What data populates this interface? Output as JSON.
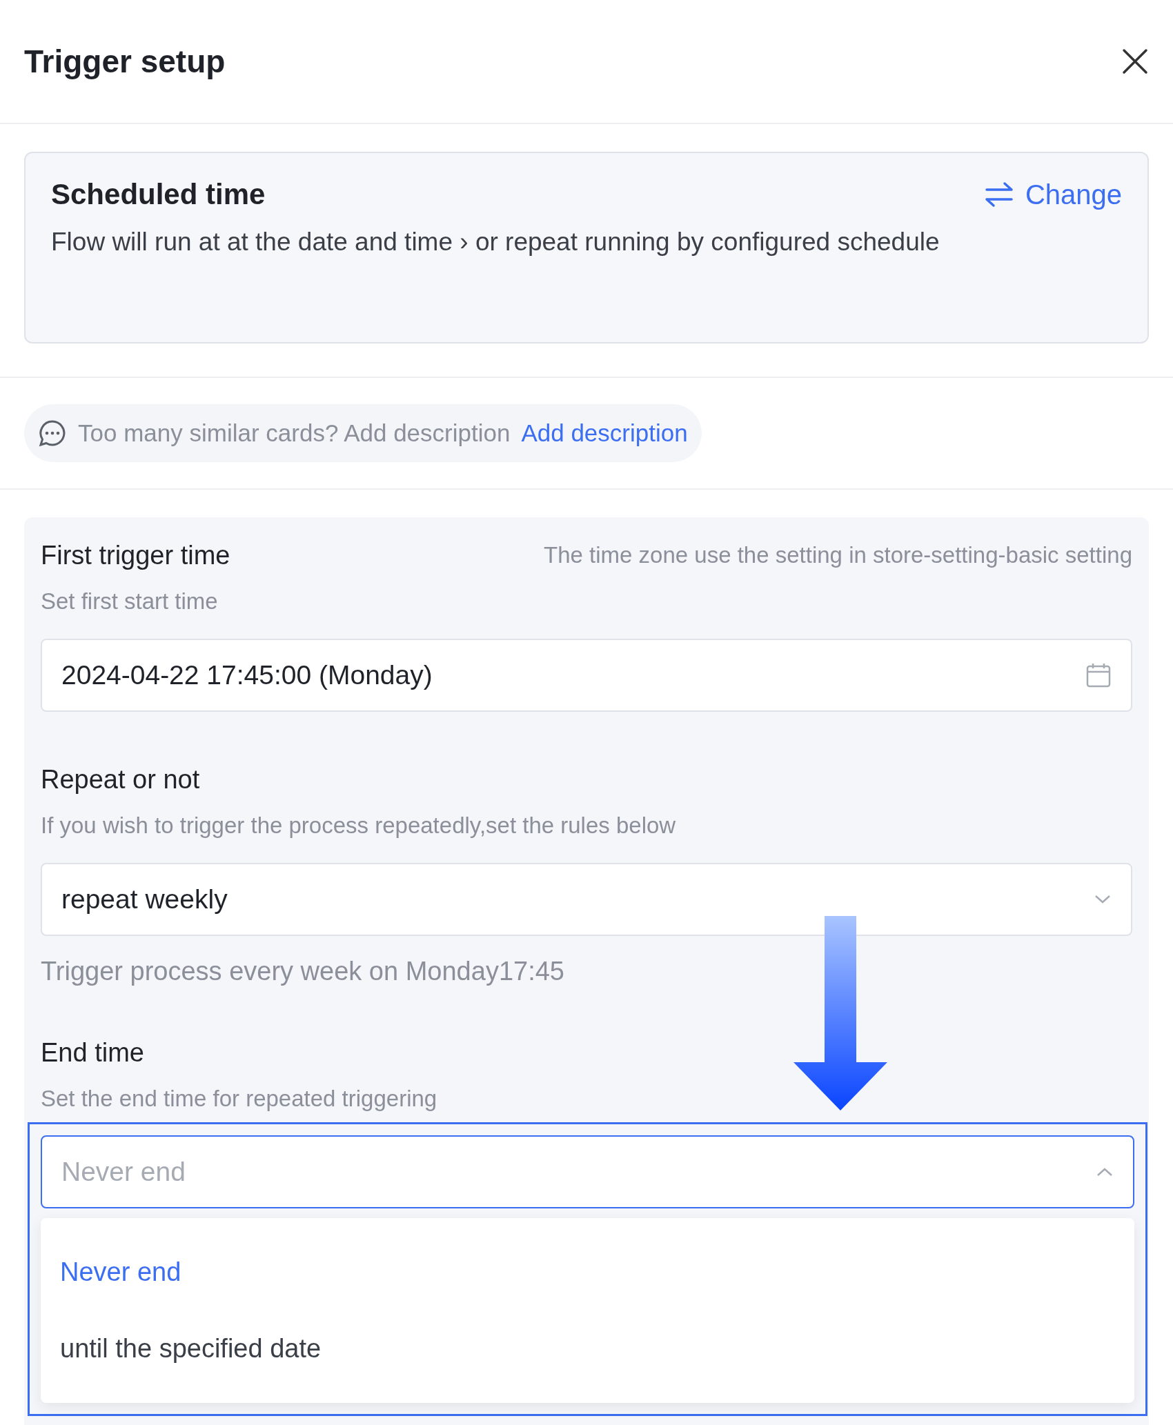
{
  "header": {
    "title": "Trigger setup"
  },
  "trigger_card": {
    "title": "Scheduled time",
    "action": "Change",
    "description": "Flow will run at at the date and time ›  or repeat running by configured schedule"
  },
  "description_hint": {
    "text": "Too many similar cards? Add description",
    "link": "Add description"
  },
  "fields": [
    {
      "kind": "date",
      "label": "First trigger time",
      "note": "The time zone use the setting in store-setting-basic setting",
      "hint": "Set first start time",
      "value": "2024-04-22 17:45:00 (Monday)",
      "highlighted": false
    },
    {
      "kind": "select",
      "label": "Repeat or not",
      "hint": "If you wish to trigger the process repeatedly,set the rules below",
      "value": "repeat weekly",
      "expanded": false,
      "helper": "Trigger process every week on Monday17:45",
      "highlighted": false
    },
    {
      "kind": "select",
      "label": "End time",
      "hint": "Set the end time for repeated triggering",
      "placeholder": "Never end",
      "expanded": true,
      "highlighted": true,
      "options": [
        {
          "label": "Never end",
          "selected": true
        },
        {
          "label": "until the specified date",
          "selected": false
        }
      ]
    }
  ]
}
